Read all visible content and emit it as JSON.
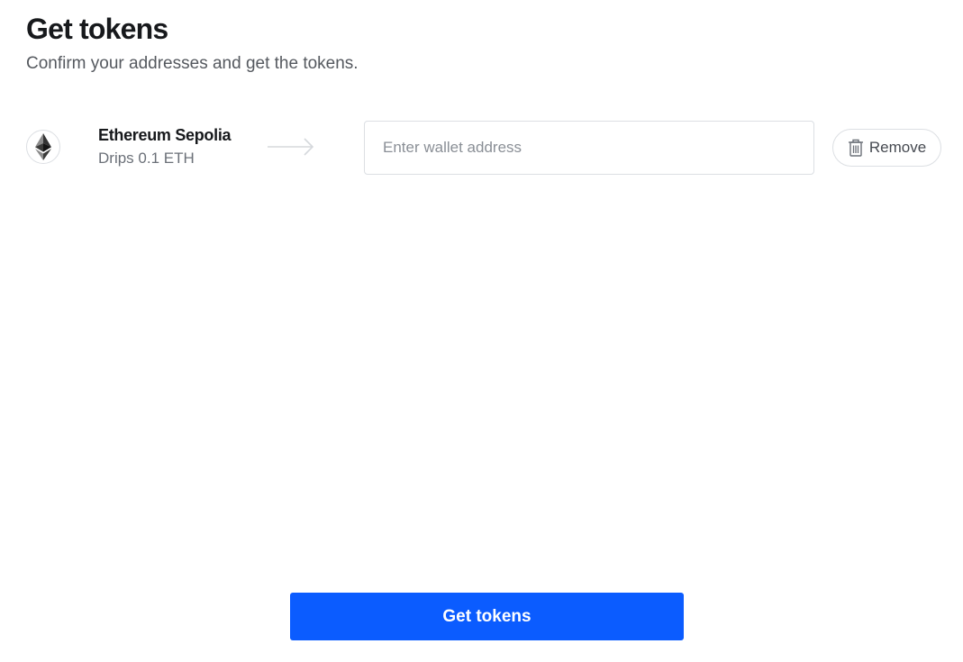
{
  "header": {
    "title": "Get tokens",
    "subtitle": "Confirm your addresses and get the tokens."
  },
  "network": {
    "name": "Ethereum Sepolia",
    "drip": "Drips 0.1 ETH",
    "logo_icon": "ethereum-logo-icon",
    "arrow_icon": "arrow-right-icon"
  },
  "wallet": {
    "value": "",
    "placeholder": "Enter wallet address"
  },
  "remove_button": {
    "label": "Remove",
    "icon": "trash-icon"
  },
  "submit_button": {
    "label": "Get tokens"
  },
  "colors": {
    "primary": "#0b5cff",
    "text": "#17191c",
    "muted": "#6b7078",
    "border": "#dcdfe3"
  }
}
